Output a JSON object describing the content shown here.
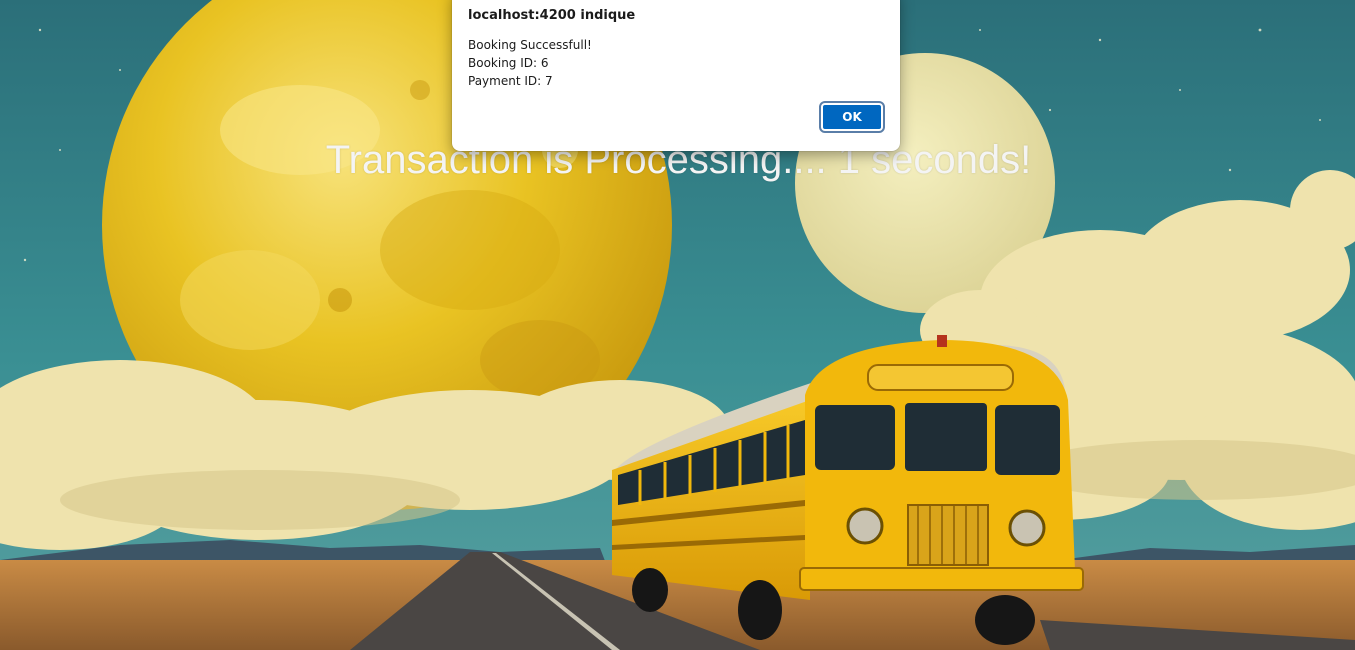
{
  "background": {
    "description_icon": "retro-bus-moons-illustration",
    "colors": {
      "sky": "#2f7f86",
      "planet": "#e8c21e",
      "moon": "#ece6a8",
      "cloud": "#efe1a8",
      "bus": "#f2b80c",
      "ground": "#b37a3a",
      "road": "#4a4644"
    }
  },
  "status": {
    "text": "Transaction is Processing.... 1 seconds!"
  },
  "alert": {
    "title": "localhost:4200 indique",
    "lines": [
      "Booking Successfull!",
      "Booking ID: 6",
      "Payment ID: 7"
    ],
    "ok_label": "OK"
  }
}
